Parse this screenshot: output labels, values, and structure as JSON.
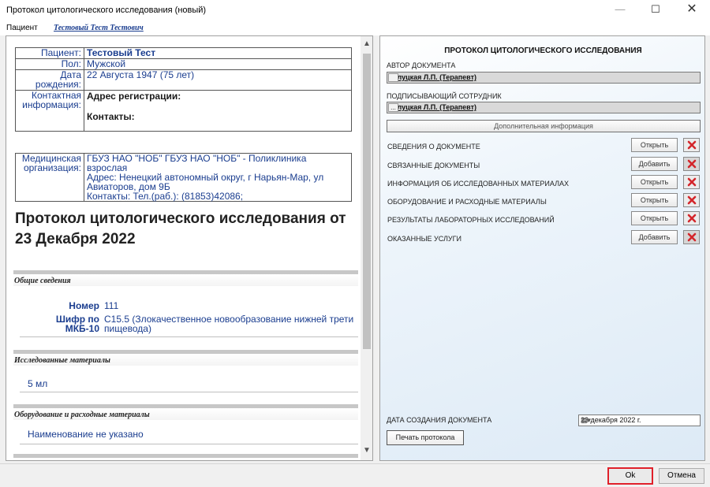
{
  "window": {
    "title": "Протокол цитологического исследования (новый)",
    "min": "—",
    "max": "☐",
    "close": "✕"
  },
  "patient_bar": {
    "label": "Пациент",
    "name_link": "Тестовый Тест Тестович"
  },
  "document": {
    "patient_table": [
      {
        "key": "Пациент:",
        "value": "Тестовый Тест"
      },
      {
        "key": "Пол:",
        "value": "Мужской"
      },
      {
        "key": "Дата рождения:",
        "value": "22 Августа 1947 (75 лет)"
      },
      {
        "key": "Контактная информация:",
        "value_line1": "Адрес регистрации:",
        "value_line2": "Контакты:"
      }
    ],
    "org_table": {
      "key": "Медицинская организация:",
      "lines": [
        "ГБУЗ НАО \"НОБ\" ГБУЗ НАО \"НОБ\" - Поликлиника взрослая",
        "Адрес: Ненецкий автономный округ, г Нарьян-Мар, ул",
        "Авиаторов, дом 9Б",
        "Контакты: Тел.(раб.): (81853)42086;"
      ]
    },
    "title_line1": "Протокол цитологического исследования от",
    "title_line2": "23 Декабря 2022",
    "sections": {
      "general": "Общие сведения",
      "materials": "Исследованные материалы",
      "equipment": "Оборудование и расходные материалы"
    },
    "number_key": "Номер",
    "number_value": "111",
    "mkb_key1": "Шифр по",
    "mkb_key2": "МКБ-10",
    "mkb_value1": "C15.5 (Злокачественное новообразование нижней трети",
    "mkb_value2": "пищевода)",
    "material_value": "5 мл",
    "equipment_value": "Наименование не указано"
  },
  "panel": {
    "title": "ПРОТОКОЛ ЦИТОЛОГИЧЕСКОГО ИССЛЕДОВАНИЯ",
    "author_label": "АВТОР ДОКУМЕНТА",
    "author_value": "Балуцкая Л.П. (Терапевт)",
    "signer_label": "ПОДПИСЫВАЮЩИЙ СОТРУДНИК",
    "signer_value": "Балуцкая Л.П. (Терапевт)",
    "ellipsis": "...",
    "additional_info": "Дополнительная информация",
    "rows": [
      {
        "label": "СВЕДЕНИЯ О ДОКУМЕНТЕ",
        "button": "Открыть"
      },
      {
        "label": "СВЯЗАННЫЕ ДОКУМЕНТЫ",
        "button": "Добавить"
      },
      {
        "label": "ИНФОРМАЦИЯ ОБ ИССЛЕДОВАННЫХ МАТЕРИАЛАХ",
        "button": "Открыть"
      },
      {
        "label": "ОБОРУДОВАНИЕ И РАСХОДНЫЕ МАТЕРИАЛЫ",
        "button": "Открыть"
      },
      {
        "label": "РЕЗУЛЬТАТЫ ЛАБОРАТОРНЫХ ИССЛЕДОВАНИЙ",
        "button": "Открыть"
      },
      {
        "label": "ОКАЗАННЫЕ УСЛУГИ",
        "button": "Добавить"
      }
    ],
    "date_label": "ДАТА СОЗДАНИЯ ДОКУМЕНТА",
    "date_value": "23 декабря 2022 г.",
    "print_button": "Печать протокола"
  },
  "footer": {
    "ok": "Ok",
    "cancel": "Отмена"
  },
  "colors": {
    "link_blue": "#1a3d8f",
    "ok_highlight": "#e0202a",
    "delete_red": "#d3262b"
  },
  "scroll": {
    "position_fraction": 0.0,
    "visible_fraction": 0.7
  }
}
